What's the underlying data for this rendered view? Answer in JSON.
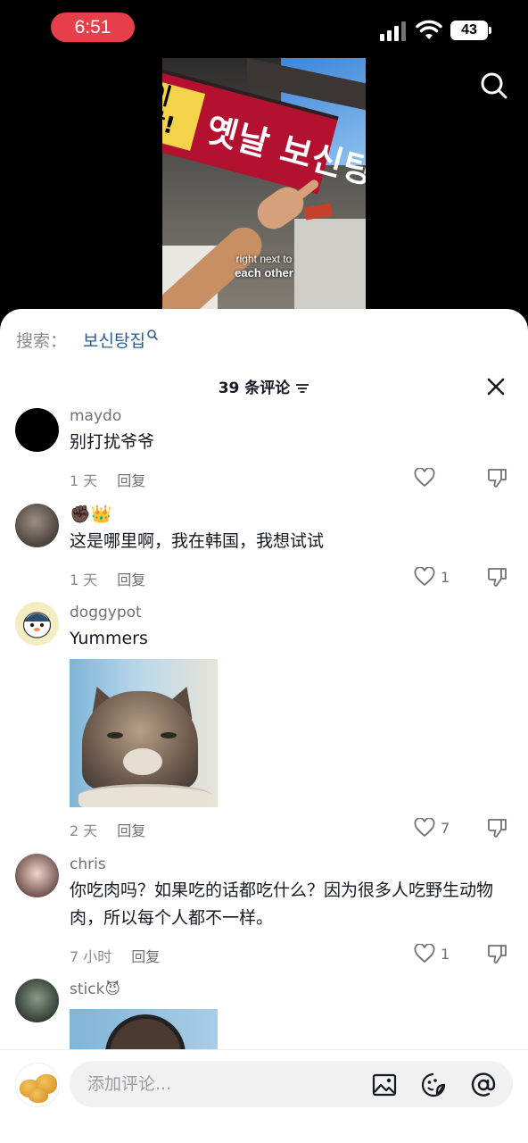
{
  "status_bar": {
    "time": "6:51",
    "battery": "43"
  },
  "video": {
    "sign_yellow": "이 맛!\n어온집",
    "sign_text": "옛날 보신탕",
    "caption_line1": "right next to",
    "caption_line2": "each other"
  },
  "search": {
    "label": "搜索：",
    "term": "보신탕집"
  },
  "sheet": {
    "title": "39 条评论"
  },
  "comments": [
    {
      "username": "maydo",
      "text": "别打扰爷爷",
      "time": "1 天",
      "reply": "回复",
      "likes": ""
    },
    {
      "username": "✊🏿👑",
      "text": "这是哪里啊，我在韩国，我想试试",
      "time": "1 天",
      "reply": "回复",
      "likes": "1"
    },
    {
      "username": "doggypot",
      "text": "Yummers",
      "time": "2 天",
      "reply": "回复",
      "likes": "7"
    },
    {
      "username": "chris",
      "text": "你吃肉吗？如果吃的话都吃什么？因为很多人吃野生动物肉，所以每个人都不一样。",
      "time": "7 小时",
      "reply": "回复",
      "likes": "1"
    },
    {
      "username": "stick😈",
      "text": "",
      "time": "",
      "reply": "",
      "likes": ""
    }
  ],
  "input": {
    "placeholder": "添加评论..."
  },
  "icons": [
    "search-icon",
    "sort-icon",
    "close-icon",
    "heart-icon",
    "dislike-icon",
    "image-icon",
    "emoji-icon",
    "mention-icon"
  ]
}
